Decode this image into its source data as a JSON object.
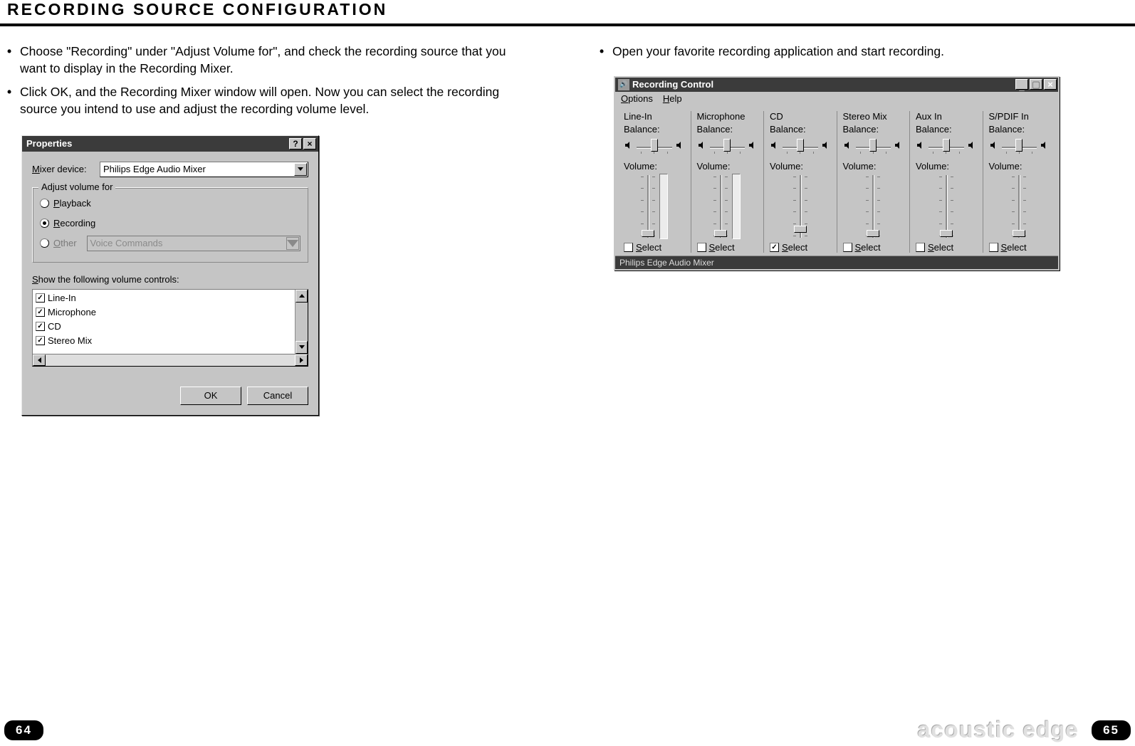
{
  "page": {
    "title": "RECORDING SOURCE CONFIGURATION",
    "left_page": "64",
    "right_page": "65",
    "brand": "acoustic edge"
  },
  "left_col": {
    "bullet1": "Choose \"Recording\" under \"Adjust Volume for\", and check the recording source that you want to display in the Recording Mixer.",
    "bullet2": "Click OK, and the Recording Mixer window will open. Now you can select the recording source you intend to use and adjust the recording volume level."
  },
  "right_col": {
    "bullet1": "Open your favorite recording application and start recording."
  },
  "properties_dialog": {
    "title": "Properties",
    "mixer_label": "Mixer device:",
    "mixer_value": "Philips Edge Audio Mixer",
    "group_legend": "Adjust volume for",
    "radio_playback": "Playback",
    "radio_recording": "Recording",
    "radio_other": "Other",
    "other_value": "Voice Commands",
    "list_label": "Show the following volume controls:",
    "items": [
      "Line-In",
      "Microphone",
      "CD",
      "Stereo Mix"
    ],
    "ok": "OK",
    "cancel": "Cancel"
  },
  "recording_control": {
    "title": "Recording Control",
    "menu_options": "Options",
    "menu_help": "Help",
    "balance_label": "Balance:",
    "volume_label": "Volume:",
    "select_label": "Select",
    "status": "Philips Edge Audio Mixer",
    "channels": [
      {
        "name": "Line-In",
        "selected": false,
        "thumb_pct": 86,
        "meter": true
      },
      {
        "name": "Microphone",
        "selected": false,
        "thumb_pct": 86,
        "meter": true
      },
      {
        "name": "CD",
        "selected": true,
        "thumb_pct": 80,
        "meter": false
      },
      {
        "name": "Stereo Mix",
        "selected": false,
        "thumb_pct": 86,
        "meter": false
      },
      {
        "name": "Aux In",
        "selected": false,
        "thumb_pct": 86,
        "meter": false
      },
      {
        "name": "S/PDIF In",
        "selected": false,
        "thumb_pct": 86,
        "meter": false
      }
    ]
  }
}
